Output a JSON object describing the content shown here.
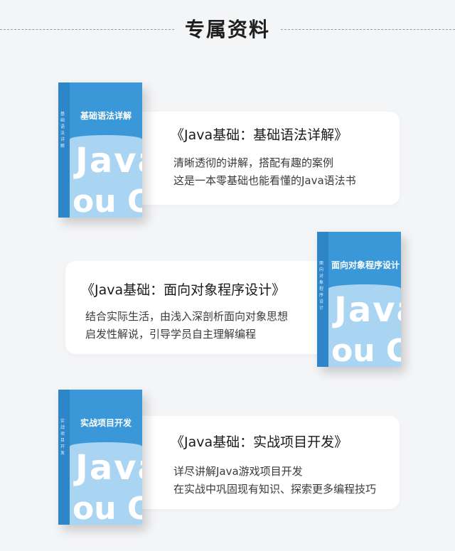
{
  "header": {
    "title": "专属资料"
  },
  "items": [
    {
      "card_title": "《Java基础：基础语法详解》",
      "desc": [
        "清晰透彻的讲解，搭配有趣的案例",
        "这是一本零基础也能看懂的Java语法书"
      ],
      "book": {
        "title": "基础语法详解",
        "spine": "基础语法详解",
        "java_text": "Java",
        "java_text2": "ou O"
      }
    },
    {
      "card_title": "《Java基础：面向对象程序设计》",
      "desc": [
        "结合实际生活，由浅入深剖析面向对象思想",
        "启发性解说，引导学员自主理解编程"
      ],
      "book": {
        "title": "面向对象程序设计",
        "spine": "面向对象程序设计",
        "java_text": "Java",
        "java_text2": "ou O"
      }
    },
    {
      "card_title": "《Java基础：实战项目开发》",
      "desc": [
        "详尽讲解Java游戏项目开发",
        "在实战中巩固现有知识、探索更多编程技巧"
      ],
      "book": {
        "title": "实战项目开发",
        "spine": "实战项目开发",
        "java_text": "Java",
        "java_text2": "ou O"
      }
    }
  ],
  "colors": {
    "background": "#f4f5f7",
    "card": "#ffffff",
    "book_blue": "#3a98d8",
    "book_light": "#a9d5f3"
  }
}
